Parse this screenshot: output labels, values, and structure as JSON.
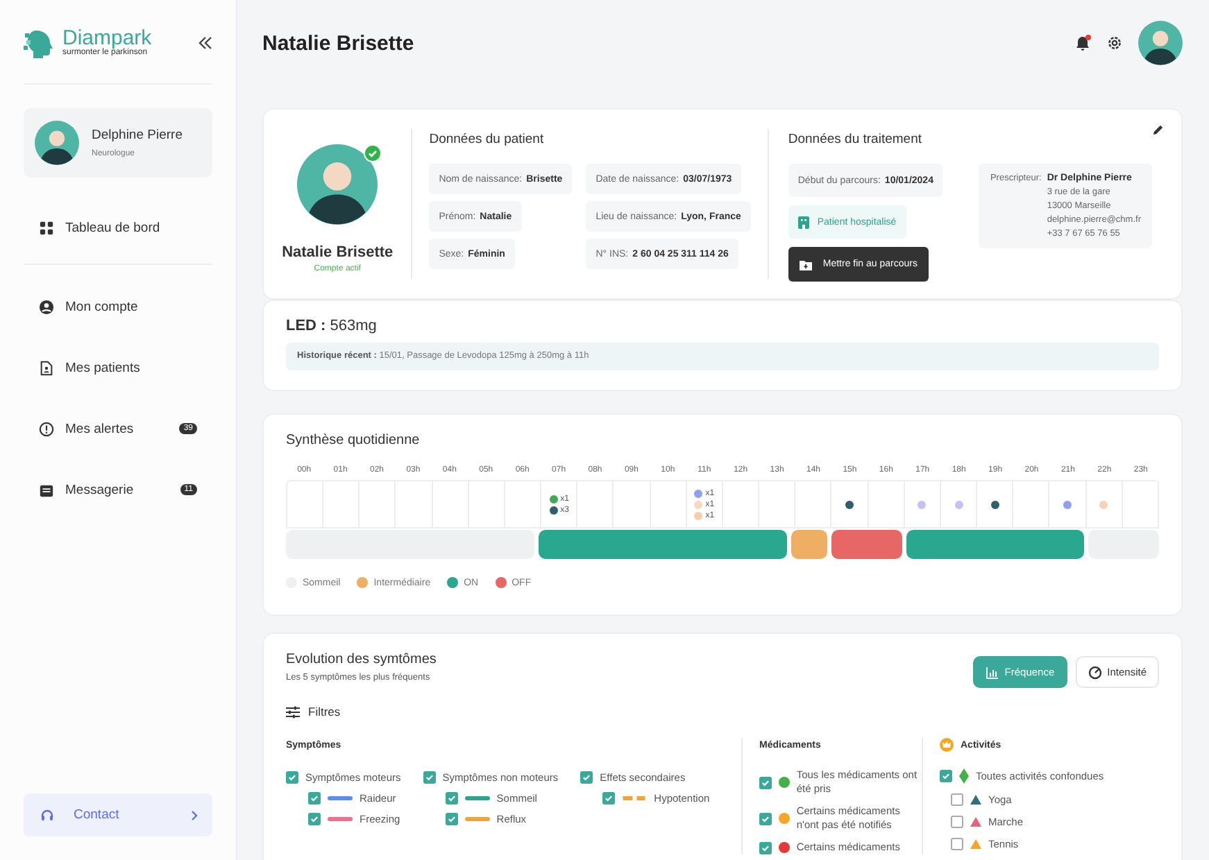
{
  "sidebar": {
    "logo": {
      "name": "Diampark",
      "tagline": "surmonter le parkinson"
    },
    "profile": {
      "name": "Delphine Pierre",
      "role": "Neurologue"
    },
    "nav_main": [
      {
        "label": "Tableau de bord",
        "kind": "dashboard",
        "selected": false
      }
    ],
    "nav": [
      {
        "label": "Mon compte",
        "kind": "account",
        "selected": false
      },
      {
        "label": "Mes patients",
        "kind": "patients",
        "selected": false
      },
      {
        "label": "Mes alertes",
        "kind": "alerts",
        "selected": false,
        "badge": "39"
      },
      {
        "label": "Messagerie",
        "kind": "messages",
        "selected": false,
        "badge": "11"
      }
    ],
    "contact": "Contact"
  },
  "header": {
    "title": "Natalie Brisette",
    "notification": true
  },
  "patient": {
    "name": "Natalie Brisette",
    "status": "Compte actif",
    "verified": true,
    "data": {
      "title": "Données du patient",
      "fields": [
        {
          "label": "Nom de naissance:",
          "value": "Brisette"
        },
        {
          "label": "Date de naissance:",
          "value": "03/07/1973"
        },
        {
          "label": "Prénom:",
          "value": "Natalie"
        },
        {
          "label": "Lieu de naissance:",
          "value": "Lyon, France"
        },
        {
          "label": "Sexe:",
          "value": "Féminin"
        },
        {
          "label": "N° INS:",
          "value": "2 60 04 25 311 114 26"
        }
      ]
    },
    "treatment": {
      "title": "Données du traitement",
      "start_label": "Début du parcours:",
      "start_value": "10/01/2024",
      "hospitalized": "Patient hospitalisé",
      "end_button": "Mettre fin au parcours",
      "prescriber": {
        "label": "Prescripteur:",
        "name": "Dr Delphine Pierre",
        "lines": [
          "3 rue de la gare",
          "13000 Marseille",
          "delphine.pierre@chm.fr",
          "+33 7 67 65 76 55"
        ]
      }
    }
  },
  "led": {
    "value": "**LED :** 563mg",
    "history": "**Historique récent :** 15/01, Passage de Levodopa 125mg à 250mg à 11h"
  },
  "synthesis": {
    "title": "Synthèse quotidienne",
    "hours": [
      {
        "label": "00h",
        "kind": "sleep"
      },
      {
        "label": "01h",
        "kind": "sleep"
      },
      {
        "label": "02h",
        "kind": "sleep"
      },
      {
        "label": "03h",
        "kind": "sleep"
      },
      {
        "label": "04h",
        "kind": "sleep"
      },
      {
        "label": "05h",
        "kind": "sleep"
      },
      {
        "label": "06h",
        "kind": "sleep"
      },
      {
        "label": "07h",
        "kind": "on",
        "markers": [
          {
            "color": "#43a857",
            "count": "x1"
          },
          {
            "color": "#2e5f6a",
            "count": "x3"
          }
        ]
      },
      {
        "label": "08h",
        "kind": "on"
      },
      {
        "label": "09h",
        "kind": "on"
      },
      {
        "label": "10h",
        "kind": "on"
      },
      {
        "label": "11h",
        "kind": "on",
        "markers": [
          {
            "color": "#8fa0f0",
            "count": "x1"
          },
          {
            "color": "#f8d8c2",
            "count": "x1"
          },
          {
            "color": "#f7cdb0",
            "count": "x1"
          }
        ]
      },
      {
        "label": "12h",
        "kind": "on"
      },
      {
        "label": "13h",
        "kind": "on"
      },
      {
        "label": "14h",
        "kind": "intermediate"
      },
      {
        "label": "15h",
        "kind": "off",
        "markers": [
          {
            "color": "#2e5f6a"
          }
        ]
      },
      {
        "label": "16h",
        "kind": "off"
      },
      {
        "label": "17h",
        "kind": "on",
        "markers": [
          {
            "color": "#c5c2f2"
          }
        ]
      },
      {
        "label": "18h",
        "kind": "on",
        "markers": [
          {
            "color": "#c5c2f2"
          }
        ]
      },
      {
        "label": "19h",
        "kind": "on",
        "markers": [
          {
            "color": "#2e5f6a"
          }
        ]
      },
      {
        "label": "20h",
        "kind": "on"
      },
      {
        "label": "21h",
        "kind": "on",
        "markers": [
          {
            "color": "#8fa0f0"
          }
        ]
      },
      {
        "label": "22h",
        "kind": "sleep",
        "markers": [
          {
            "color": "#f8d2b6"
          }
        ]
      },
      {
        "label": "23h",
        "kind": "sleep"
      }
    ],
    "legend": [
      {
        "label": "Sommeil",
        "kind": "sleep",
        "color": "#eff0f2"
      },
      {
        "label": "Intermédiaire",
        "kind": "intermediate",
        "color": "#eeae63"
      },
      {
        "label": "ON",
        "kind": "on",
        "color": "#29a88f"
      },
      {
        "label": "OFF",
        "kind": "off",
        "color": "#e76666"
      }
    ]
  },
  "evolution": {
    "title": "Evolution des symtômes",
    "subtitle": "Les 5 symptômes les plus fréquents",
    "views": [
      {
        "label": "Fréquence",
        "kind": "bars",
        "selected": true
      },
      {
        "label": "Intensité",
        "kind": "dial",
        "selected": false
      }
    ],
    "filters": "Filtres",
    "symptoms": {
      "title": "Symptômes",
      "groups": [
        {
          "label": "Symptômes moteurs",
          "checked": true,
          "items": [
            {
              "label": "Raideur",
              "checked": true,
              "color": "#5b8cf0",
              "kind": "solid"
            },
            {
              "label": "Freezing",
              "checked": true,
              "color": "#ec6f8c",
              "kind": "solid"
            }
          ]
        },
        {
          "label": "Symptômes non moteurs",
          "checked": true,
          "items": [
            {
              "label": "Sommeil",
              "checked": true,
              "color": "#2aa58f",
              "kind": "solid"
            },
            {
              "label": "Reflux",
              "checked": true,
              "color": "#f2a33a",
              "kind": "solid"
            }
          ]
        },
        {
          "label": "Effets secondaires",
          "checked": true,
          "items": [
            {
              "label": "Hypotention",
              "checked": true,
              "color": "#f2a33a",
              "kind": "dashed"
            }
          ]
        }
      ]
    },
    "medications": {
      "title": "Médicaments",
      "items": [
        {
          "label": "Tous les médicaments ont été pris",
          "checked": true,
          "color": "#43b04a"
        },
        {
          "label": "Certains médicaments n'ont pas été notifiés",
          "checked": true,
          "color": "#f5a623"
        },
        {
          "label": "Certains médicaments",
          "checked": true,
          "color": "#e53935"
        }
      ]
    },
    "activities": {
      "title": "Activités",
      "all": {
        "label": "Toutes activités confondues",
        "checked": true
      },
      "items": [
        {
          "label": "Yoga",
          "checked": false,
          "color": "#2e6f7e"
        },
        {
          "label": "Marche",
          "checked": false,
          "color": "#e8617a"
        },
        {
          "label": "Tennis",
          "checked": false,
          "color": "#f5a623"
        }
      ]
    }
  }
}
